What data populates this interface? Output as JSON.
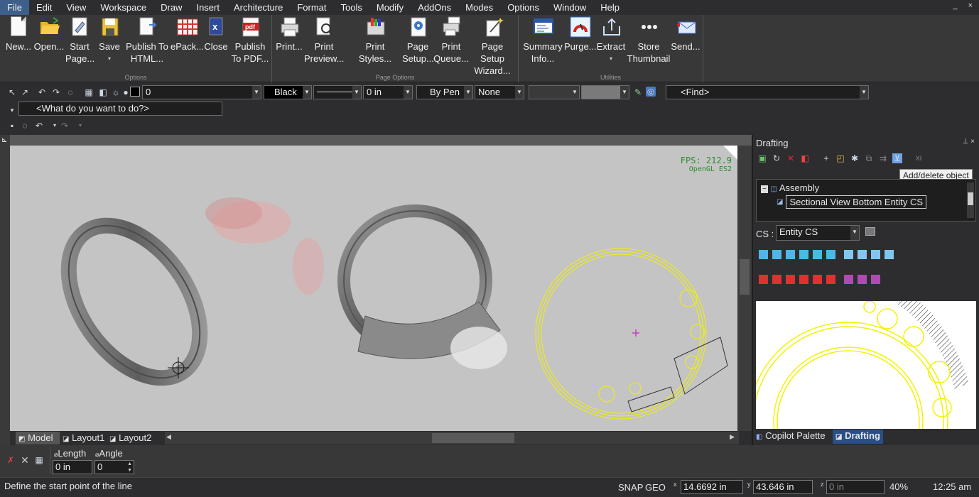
{
  "menu": [
    "File",
    "Edit",
    "View",
    "Workspace",
    "Draw",
    "Insert",
    "Architecture",
    "Format",
    "Tools",
    "Modify",
    "AddOns",
    "Modes",
    "Options",
    "Window",
    "Help"
  ],
  "window_controls": "_  ×",
  "ribbon": {
    "groups": [
      "Options",
      "Page Options",
      "Utilities"
    ],
    "buttons": [
      {
        "label": "New...",
        "icon": "new-file-icon"
      },
      {
        "label": "Open...",
        "icon": "open-folder-icon"
      },
      {
        "label": "Start Page...",
        "icon": "start-page-icon"
      },
      {
        "label": "Save",
        "icon": "save-icon"
      },
      {
        "label": "Publish To HTML...",
        "icon": "publish-html-icon"
      },
      {
        "label": "ePack...",
        "icon": "epack-icon"
      },
      {
        "label": "Close",
        "icon": "close-file-icon"
      },
      {
        "label": "Publish To PDF...",
        "icon": "pdf-icon"
      },
      {
        "label": "Print...",
        "icon": "printer-icon"
      },
      {
        "label": "Print Preview...",
        "icon": "print-preview-icon"
      },
      {
        "label": "Print Styles...",
        "icon": "print-styles-icon"
      },
      {
        "label": "Page Setup...",
        "icon": "page-setup-icon"
      },
      {
        "label": "Print Queue...",
        "icon": "print-queue-icon"
      },
      {
        "label": "Page Setup Wizard...",
        "icon": "wizard-icon"
      },
      {
        "label": "Summary Info...",
        "icon": "summary-icon"
      },
      {
        "label": "Purge...",
        "icon": "purge-icon"
      },
      {
        "label": "Extract",
        "icon": "extract-icon"
      },
      {
        "label": "Store Thumbnail",
        "icon": "thumbnail-icon"
      },
      {
        "label": "Send...",
        "icon": "send-mail-icon"
      }
    ]
  },
  "toolbar": {
    "layer_value": "0",
    "color_value": "Black",
    "lineweight_value": "0 in",
    "pen_value": "By Pen",
    "fill_value": "None",
    "find_placeholder": "<Find>",
    "search_placeholder": "<What do you want to do?>"
  },
  "viewport": {
    "fps_text": "FPS: 212.9",
    "renderer_text": "OpenGL ES2"
  },
  "layout_tabs": [
    "Model",
    "Layout1",
    "Layout2"
  ],
  "panel": {
    "title": "Drafting",
    "tooltip": "Add/delete object",
    "tree_root": "Assembly",
    "tree_child": "Sectional View Bottom Entity CS",
    "cs_label": "CS :",
    "cs_value": "Entity CS",
    "tabs": [
      "Copilot Palette",
      "Drafting"
    ]
  },
  "command_bar": {
    "length_label": "Length",
    "angle_label": "Angle",
    "length_value": "0 in",
    "angle_value": "0"
  },
  "status": {
    "prompt": "Define the start point of the line",
    "snap": "SNAP",
    "geo": "GEO",
    "x_value": "14.6692 in",
    "y_value": "43.646 in",
    "z_value": "0 in",
    "zoom": "40%",
    "time": "12:25 am"
  },
  "colors": {
    "accent": "#3e5f8a",
    "drafting_yellow": "#f2f200",
    "fps_green": "#2e8b2e"
  }
}
